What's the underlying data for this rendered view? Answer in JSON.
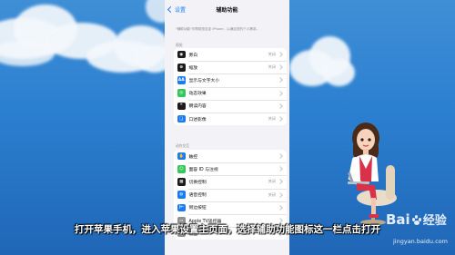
{
  "nav": {
    "back_label": "设置",
    "title": "辅助功能"
  },
  "description": "\"辅助功能\"可帮助您自定 iPhone，以满足您的个人需求。",
  "sections": [
    {
      "header": "视觉",
      "items": [
        {
          "label": "旁白",
          "value": "关闭",
          "icon": "voiceover-icon",
          "color": "#1c1c1e"
        },
        {
          "label": "缩放",
          "value": "关闭",
          "icon": "zoom-icon",
          "color": "#1c1c1e"
        },
        {
          "label": "显示与文字大小",
          "value": "",
          "icon": "text-size-icon",
          "color": "#1a7cf5"
        },
        {
          "label": "动态效果",
          "value": "",
          "icon": "motion-icon",
          "color": "#34c759"
        },
        {
          "label": "朗读内容",
          "value": "",
          "icon": "speech-icon",
          "color": "#1c1c1e"
        },
        {
          "label": "口述影像",
          "value": "关闭",
          "icon": "audio-description-icon",
          "color": "#1a7cf5"
        }
      ]
    },
    {
      "header": "动作交互",
      "items": [
        {
          "label": "触控",
          "value": "",
          "icon": "touch-icon",
          "color": "#1a7cf5"
        },
        {
          "label": "面容 ID 与注视",
          "value": "",
          "icon": "face-id-icon",
          "color": "#34c759"
        },
        {
          "label": "切换控制",
          "value": "关闭",
          "icon": "switch-control-icon",
          "color": "#1c1c1e"
        },
        {
          "label": "语音控制",
          "value": "关闭",
          "icon": "voice-control-icon",
          "color": "#1a7cf5"
        },
        {
          "label": "侧边按钮",
          "value": "",
          "icon": "side-button-icon",
          "color": "#1a7cf5"
        },
        {
          "label": "Apple TV遥控器",
          "value": "",
          "icon": "apple-tv-remote-icon",
          "color": "#8e8e93"
        },
        {
          "label": "键盘",
          "value": "",
          "icon": "keyboard-icon",
          "color": "#8e8e93"
        }
      ]
    }
  ],
  "icon_glyphs": [
    "◉",
    "⊕",
    "AA",
    "◎",
    "❝",
    "❏",
    "✋",
    "☺",
    "▦",
    "◍",
    "|←",
    "▭",
    "⌨"
  ],
  "subtitle": "打开苹果手机，进入苹果设置主页面，选择辅助功能图标这一栏点击打开",
  "watermark": {
    "brand": "Baidu 经验",
    "url": "jingyan.baidu.com"
  }
}
